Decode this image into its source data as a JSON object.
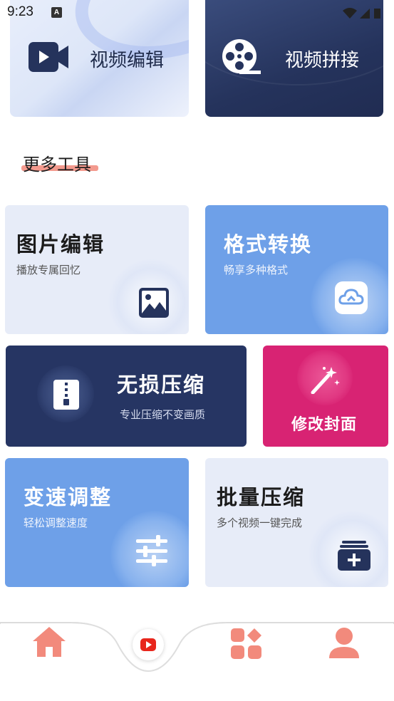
{
  "status_bar": {
    "time": "9:23",
    "notification_glyph": "A"
  },
  "top_cards": [
    {
      "label": "视频编辑",
      "icon": "video-camera-icon"
    },
    {
      "label": "视频拼接",
      "icon": "film-reel-icon"
    }
  ],
  "section": {
    "title": "更多工具"
  },
  "tiles": {
    "image_edit": {
      "title": "图片编辑",
      "subtitle": "播放专属回忆",
      "icon": "image-icon"
    },
    "format_convert": {
      "title": "格式转换",
      "subtitle": "畅享多种格式",
      "icon": "cloud-icon"
    },
    "lossless_compress": {
      "title": "无损压缩",
      "subtitle": "专业压缩不变画质",
      "icon": "zip-file-icon"
    },
    "edit_cover": {
      "title": "修改封面",
      "icon": "magic-wand-icon"
    },
    "speed_adjust": {
      "title": "变速调整",
      "subtitle": "轻松调整速度",
      "icon": "sliders-icon"
    },
    "batch_compress": {
      "title": "批量压缩",
      "subtitle": "多个视频一键完成",
      "icon": "add-box-icon"
    }
  },
  "bottom_nav": [
    {
      "name": "home",
      "icon": "home-icon"
    },
    {
      "name": "play",
      "icon": "play-icon"
    },
    {
      "name": "apps",
      "icon": "apps-grid-icon"
    },
    {
      "name": "profile",
      "icon": "person-icon"
    }
  ],
  "colors": {
    "navy": "#263563",
    "blue": "#6ea0e8",
    "pale": "#e7ecf8",
    "pink": "#d82373",
    "accent_underline": "#f39a8e",
    "nav_icon": "#f28a7c"
  }
}
